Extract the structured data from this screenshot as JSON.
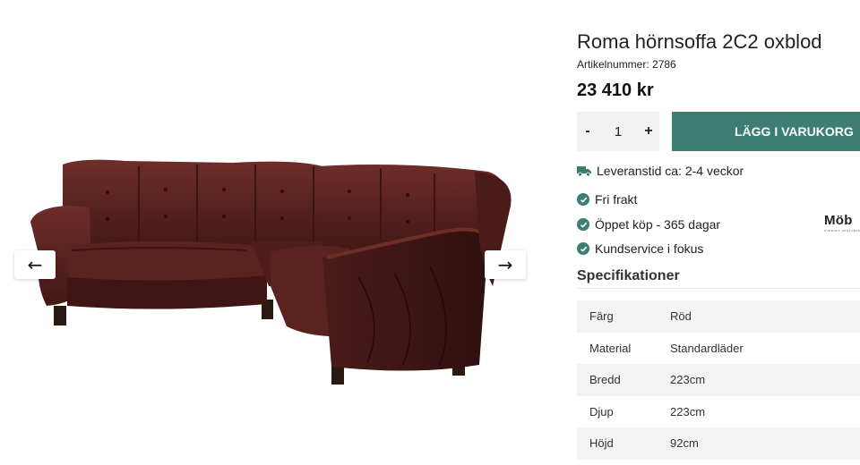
{
  "gallery": {
    "prev_icon": "arrow-left-icon",
    "next_icon": "arrow-right-icon",
    "prev_glyph": "←",
    "next_glyph": "→"
  },
  "product": {
    "title": "Roma hörnsoffa 2C2 oxblod",
    "article_number": "Artikelnummer: 2786",
    "price": "23 410 kr",
    "color_hex": "#5a2320"
  },
  "quantity": {
    "minus": "-",
    "value": "1",
    "plus": "+"
  },
  "cart": {
    "label": "LÄGG I VARUKORG",
    "color": "#3e7d72"
  },
  "delivery": {
    "icon": "truck-icon",
    "text": "Leveranstid ca: 2-4 veckor"
  },
  "usps": [
    {
      "icon": "check-circle-icon",
      "text": "Fri frakt"
    },
    {
      "icon": "check-circle-icon",
      "text": "Öppet köp - 365 dagar"
    },
    {
      "icon": "check-circle-icon",
      "text": "Kundservice i fokus"
    }
  ],
  "brand": {
    "word": "Möb",
    "tagline": "SVENSKT HANTVERK"
  },
  "specs": {
    "heading": "Specifikationer",
    "rows": [
      {
        "key": "Färg",
        "value": "Röd"
      },
      {
        "key": "Material",
        "value": "Standardläder"
      },
      {
        "key": "Bredd",
        "value": "223cm"
      },
      {
        "key": "Djup",
        "value": "223cm"
      },
      {
        "key": "Höjd",
        "value": "92cm"
      }
    ]
  }
}
